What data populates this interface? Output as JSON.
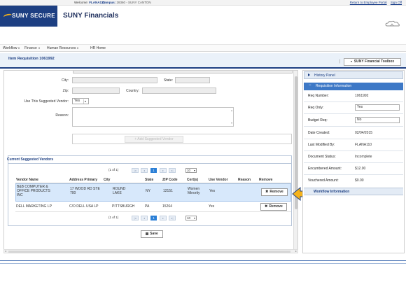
{
  "header": {
    "welcome_label": "Welcome:",
    "welcome_user": "FLANA110",
    "campus_label": "Campus:",
    "campus_value": "28360 - SUNY CANTON",
    "links": [
      "Return to Employee Portal",
      "Sign Off"
    ],
    "logo_text": "SUNY SECURE",
    "app_title": "SUNY Financials"
  },
  "nav": {
    "items": [
      "Workflow",
      "Finance",
      "Human Resources",
      "HR Home"
    ]
  },
  "page": {
    "item_title": "Item Requisition 1061992",
    "toolbox_label": "SUNY Financial Toolbox"
  },
  "form": {
    "city_label": "City:",
    "state_label": "State:",
    "zip_label": "Zip:",
    "country_label": "Country:",
    "use_suggested_label": "Use This Suggested Vendor:",
    "use_suggested_value": "Yes",
    "reason_label": "Reason:",
    "add_button_label": "+ Add Suggested Vendor"
  },
  "vendors_panel": {
    "title": "Current Suggested Vendors",
    "pager": {
      "info": "(1 of 1)",
      "current_page": "1",
      "page_size": "10"
    },
    "columns": [
      "Vendor Name",
      "Address Primary",
      "City",
      "State",
      "ZIP Code",
      "Cert(s)",
      "Use Vendor",
      "Reason",
      "Remove"
    ],
    "rows": [
      {
        "vendor_name": "B&B COMPUTER &\nOFFICE PRODUCTS\nINC",
        "address": "17 WOOD RD STE\n700",
        "city": "ROUND\nLAKE",
        "state": "NY",
        "zip": "12151",
        "certs": "Women\nMinority",
        "use_vendor": "Yes",
        "reason": "",
        "remove_label": "Remove"
      },
      {
        "vendor_name": "DELL MARKETING LP",
        "address": "C/O DELL USA LP",
        "city": "PITTSBURGH",
        "state": "PA",
        "zip": "15264",
        "certs": "",
        "use_vendor": "Yes",
        "reason": "",
        "remove_label": "Remove"
      }
    ],
    "save_label": "Save"
  },
  "right_panel": {
    "history_label": "History Panel",
    "req_info_label": "Requisition Information",
    "fields": [
      {
        "key": "Req Number:",
        "value": "1061992",
        "boxed": false
      },
      {
        "key": "Req Only:",
        "value": "Yes",
        "boxed": true
      },
      {
        "key": "Budget Req:",
        "value": "No",
        "boxed": true
      },
      {
        "key": "Date Created:",
        "value": "02/04/2015",
        "boxed": false
      },
      {
        "key": "Last Modified By:",
        "value": "FLANA110",
        "boxed": false
      },
      {
        "key": "Document Status:",
        "value": "Incomplete",
        "boxed": false
      },
      {
        "key": "Encumbered Amount:",
        "value": "$12.00",
        "boxed": false
      },
      {
        "key": "Vouchered Amount:",
        "value": "$0.00",
        "boxed": false
      }
    ],
    "workflow_label": "Workflow Information"
  },
  "colors": {
    "brand_navy": "#1d3f82",
    "accent_blue": "#3d78c6",
    "selected_row": "#d7e8fb",
    "annotation_arrow": "#f5b21a"
  }
}
